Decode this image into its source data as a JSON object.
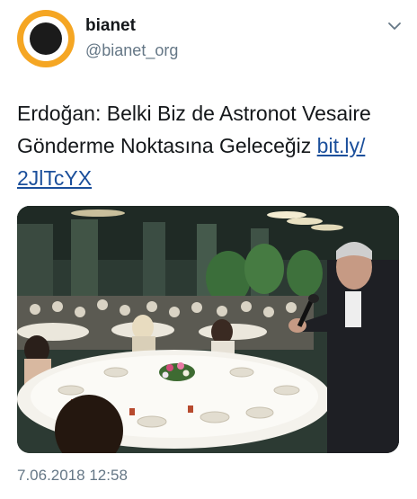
{
  "account": {
    "display_name": "bianet",
    "handle": "@bianet_org",
    "avatar_color": "#f5a623"
  },
  "tweet": {
    "text_part1": "Erdoğan: Belki Biz de Astronot Vesaire Gönderme Noktasına Geleceğiz ",
    "link_part1": "bit.ly/",
    "link_part2": "2JlTcYX",
    "link_color": "#1b4f9b"
  },
  "media": {
    "description_icon": "photo"
  },
  "timestamp": "7.06.2018 12:58",
  "icons": {
    "menu": "chevron-down-icon"
  }
}
